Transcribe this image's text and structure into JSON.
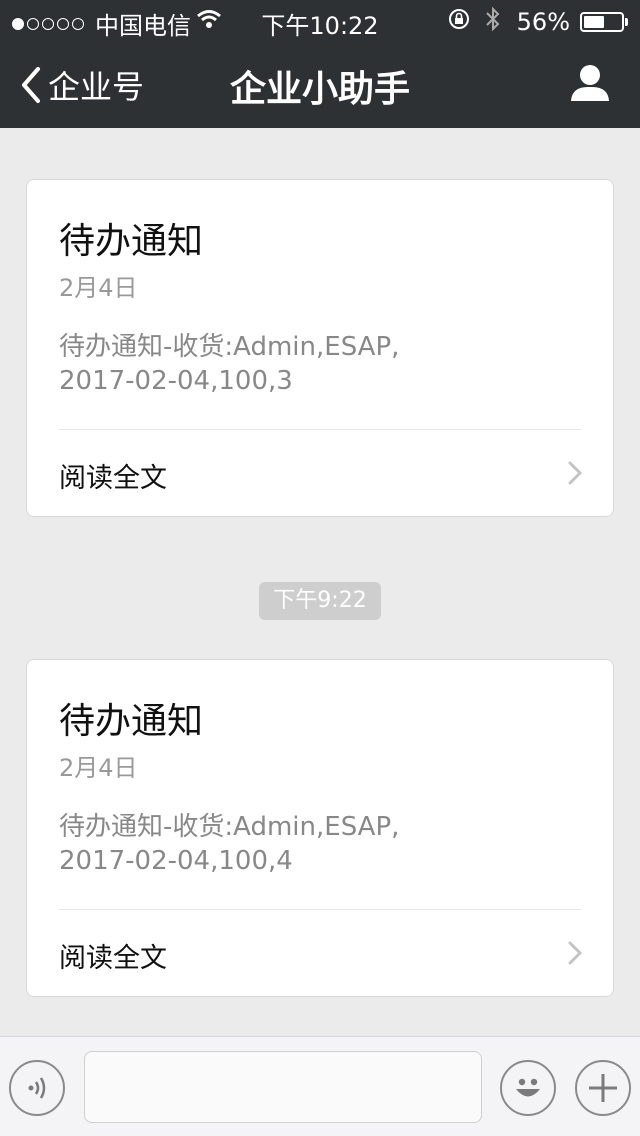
{
  "status_bar": {
    "carrier": "中国电信",
    "time": "下午10:22",
    "battery": "56%",
    "battery_level": 0.56
  },
  "nav": {
    "back_label": "企业号",
    "title": "企业小助手"
  },
  "messages": [
    {
      "title": "待办通知",
      "date": "2月4日",
      "body_line1": "待办通知-收货:Admin,ESAP,",
      "body_line2": "2017-02-04,100,3",
      "read_label": "阅读全文"
    },
    {
      "title": "待办通知",
      "date": "2月4日",
      "body_line1": "待办通知-收货:Admin,ESAP,",
      "body_line2": "2017-02-04,100,4",
      "read_label": "阅读全文"
    }
  ],
  "time_separator": "下午9:22",
  "input": {
    "placeholder": ""
  },
  "icons": {
    "back": "chevron-left-icon",
    "profile": "person-icon",
    "voice": "voice-icon",
    "emoji": "smiley-icon",
    "more": "plus-icon"
  }
}
